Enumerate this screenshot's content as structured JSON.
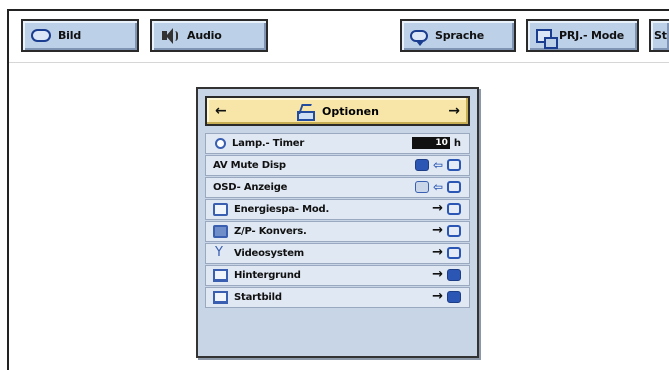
{
  "tabs": [
    {
      "id": "bild",
      "label": "Bild",
      "icon": "picture-oval-icon"
    },
    {
      "id": "audio",
      "label": "Audio",
      "icon": "speaker-icon"
    },
    {
      "id": "sprache",
      "label": "Sprache",
      "icon": "speech-bubble-icon"
    },
    {
      "id": "prj",
      "label": "PRJ.- Mode",
      "icon": "projector-monitor-icon"
    },
    {
      "id": "st",
      "label": "St",
      "icon": ""
    }
  ],
  "panel": {
    "title": "Optionen",
    "left_arrow": "←",
    "right_arrow": "→",
    "items": [
      {
        "label": "Lamp.- Timer",
        "icon": "lamp-sun-icon",
        "value": "10",
        "unit": "h"
      },
      {
        "label": "AV Mute Disp",
        "icon": "",
        "state": "on"
      },
      {
        "label": "OSD- Anzeige",
        "icon": "",
        "state": "on"
      },
      {
        "label": "Energiespa- Mod.",
        "icon": "power-save-icon",
        "action": "→"
      },
      {
        "label": "Z/P- Konvers.",
        "icon": "conversion-icon",
        "action": "→"
      },
      {
        "label": "Videosystem",
        "icon": "antenna-icon",
        "action": "→"
      },
      {
        "label": "Hintergrund",
        "icon": "background-icon",
        "action": "→"
      },
      {
        "label": "Startbild",
        "icon": "startup-image-icon",
        "action": "→"
      }
    ]
  },
  "colors": {
    "tab_bg": "#bcd0e8",
    "panel_bg": "#c8d5e6",
    "header_bg": "#f7e6a8",
    "accent": "#2b56b4"
  }
}
